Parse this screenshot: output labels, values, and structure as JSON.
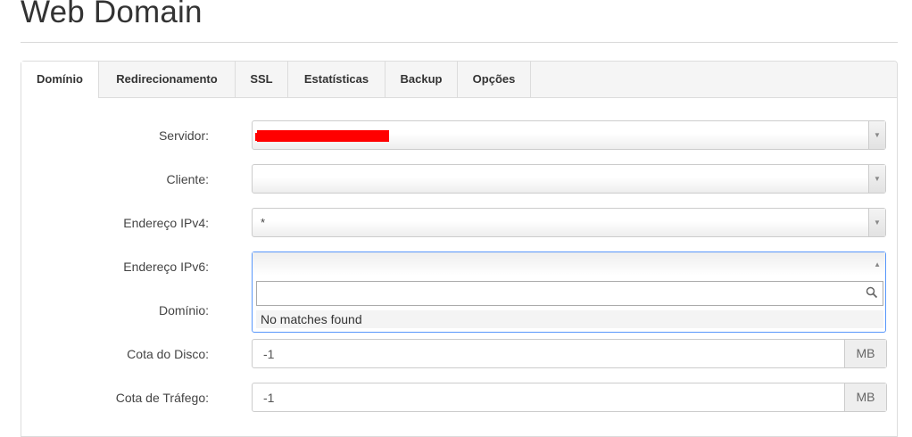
{
  "page": {
    "title": "Web Domain"
  },
  "tabs": [
    {
      "label": "Domínio",
      "active": true
    },
    {
      "label": "Redirecionamento"
    },
    {
      "label": "SSL"
    },
    {
      "label": "Estatísticas"
    },
    {
      "label": "Backup"
    },
    {
      "label": "Opções"
    }
  ],
  "form": {
    "servidor": {
      "label": "Servidor:",
      "value": ""
    },
    "cliente": {
      "label": "Cliente:",
      "value": ""
    },
    "ipv4": {
      "label": "Endereço IPv4:",
      "value": "*"
    },
    "ipv6": {
      "label": "Endereço IPv6:",
      "search_value": "",
      "no_matches": "No matches found"
    },
    "dominio": {
      "label": "Domínio:"
    },
    "cota_disco": {
      "label": "Cota do Disco:",
      "value": "-1",
      "unit": "MB"
    },
    "cota_trafego": {
      "label": "Cota de Tráfego:",
      "value": "-1",
      "unit": "MB"
    }
  },
  "colors": {
    "redaction": "#ff0000",
    "focus_border": "#5897fb"
  },
  "icons": {
    "select_arrow": "caret-down-icon",
    "select_open_arrow": "caret-up-icon",
    "search": "magnifier-icon"
  }
}
